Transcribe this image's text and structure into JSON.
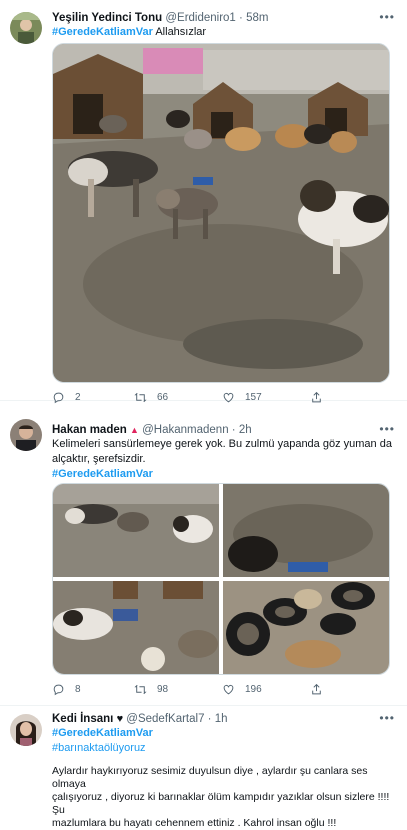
{
  "tweets": [
    {
      "name": "Yeşilin Yedinci Tonu",
      "handle": "@Erdideniro1",
      "time": "58m",
      "hashtag": "#GeredeKatliamVar",
      "body": "Allahsızlar",
      "replies": "2",
      "retweets": "66",
      "likes": "157"
    },
    {
      "name": "Hakan maden",
      "handle": "@Hakanmadenn",
      "time": "2h",
      "line1": "Kelimeleri sansürlemeye gerek yok. Bu zulmü yapanda göz yuman da",
      "line2": "alçaktır, şerefsizdir.",
      "hashtag": "#GeredeKatliamVar",
      "replies": "8",
      "retweets": "98",
      "likes": "196"
    },
    {
      "name": "Kedi İnsanı",
      "handle": "@SedefKartal7",
      "time": "1h",
      "hashtag1": "#GeredeKatliamVar",
      "hashtag2": "#barınaktaölüyoruz",
      "line1": "Aylardır haykırıyoruz sesimiz duyulsun diye , aylardır şu canlara ses olmaya",
      "line2": "çalışıyoruz , diyoruz ki barınaklar ölüm kampıdır yazıklar olsun sizlere !!!! Şu",
      "line3": "mazlumlara bu hayatı cehennem ettiniz . Kahrol insan oğlu !!!"
    }
  ],
  "more_glyph": "•••",
  "colors": {
    "link": "#1d9bf0",
    "muted": "#536471",
    "border": "#eff3f4"
  }
}
